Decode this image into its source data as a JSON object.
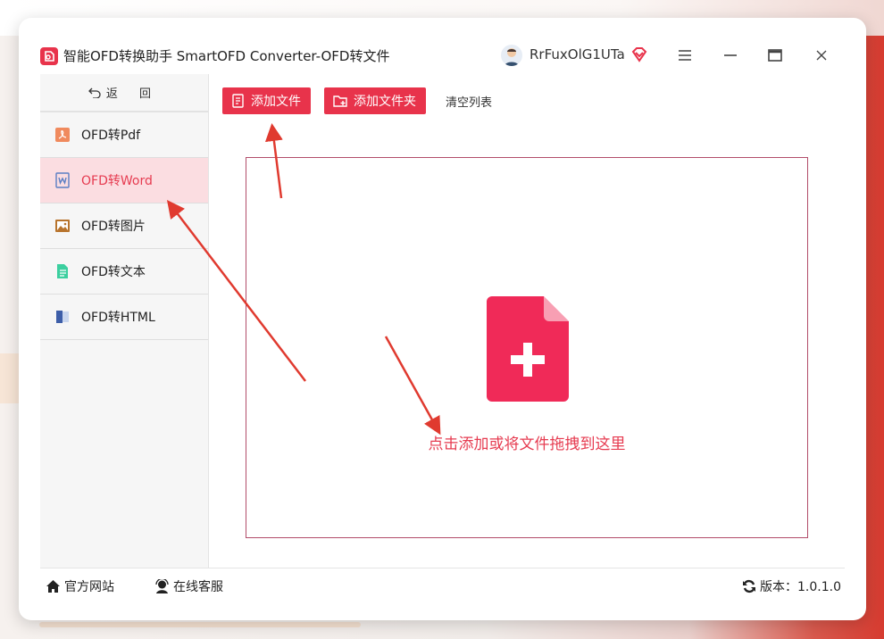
{
  "window": {
    "title": "智能OFD转换助手 SmartOFD Converter-OFD转文件",
    "username": "RrFuxOlG1UTa",
    "controls": [
      "menu-icon",
      "minimize-icon",
      "maximize-icon",
      "close-icon"
    ]
  },
  "sidebar": {
    "back_label": "返 回",
    "items": [
      {
        "label": "OFD转Pdf",
        "icon": "pdf-icon",
        "active": false
      },
      {
        "label": "OFD转Word",
        "icon": "word-icon",
        "active": true
      },
      {
        "label": "OFD转图片",
        "icon": "image-icon",
        "active": false
      },
      {
        "label": "OFD转文本",
        "icon": "text-icon",
        "active": false
      },
      {
        "label": "OFD转HTML",
        "icon": "html-icon",
        "active": false
      }
    ]
  },
  "toolbar": {
    "add_file": "添加文件",
    "add_folder": "添加文件夹",
    "clear_list": "清空列表"
  },
  "dropzone": {
    "hint": "点击添加或将文件拖拽到这里"
  },
  "footer": {
    "website": "官方网站",
    "service": "在线客服",
    "version": "版本：1.0.1.0"
  },
  "colors": {
    "accent": "#e8334b",
    "active_bg": "#fbdde1",
    "annotation_arrow": "#e03a2f"
  }
}
